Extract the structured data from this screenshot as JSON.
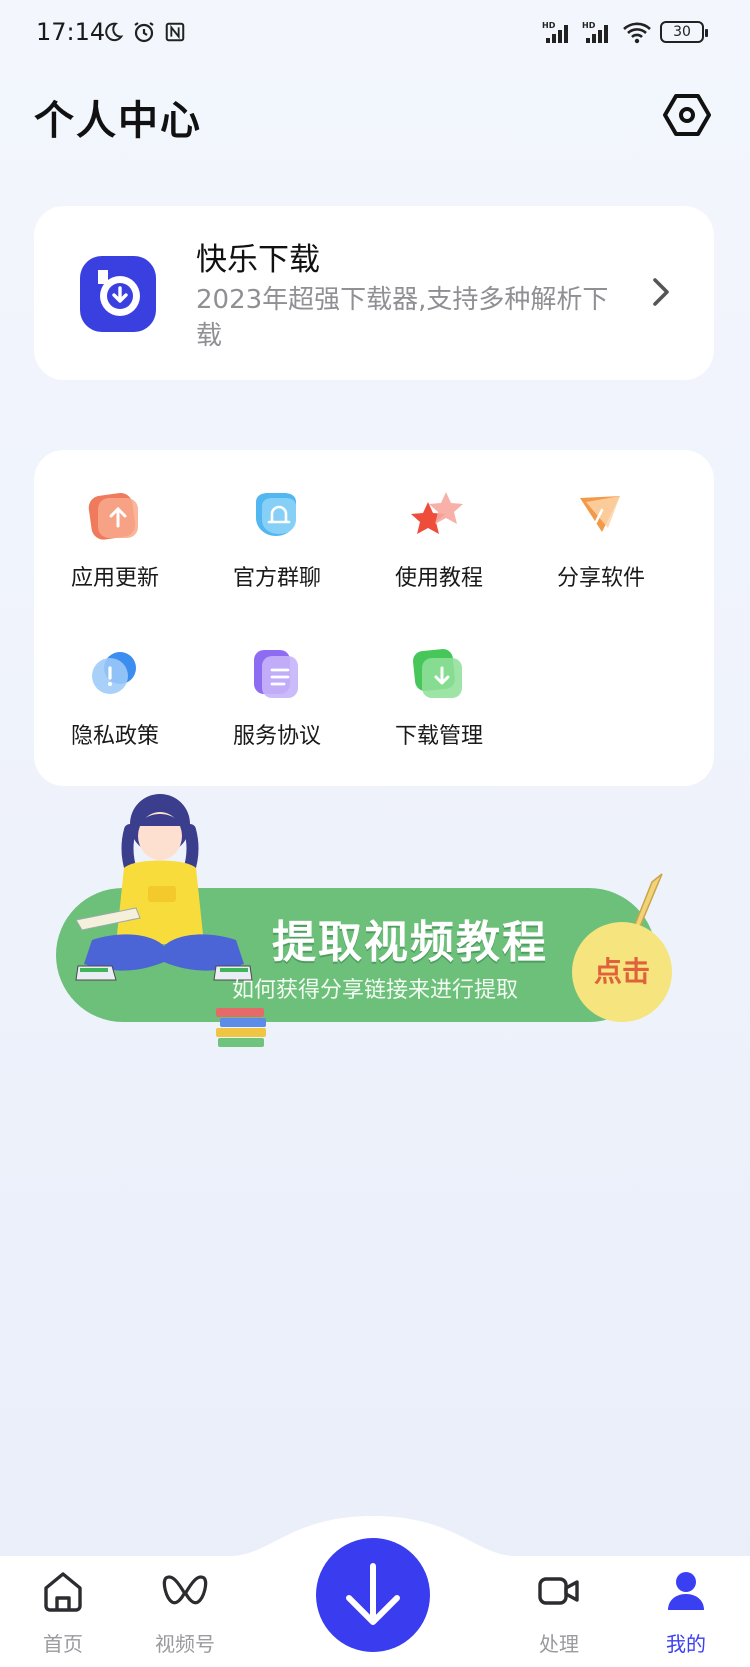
{
  "status_bar": {
    "time": "17:14",
    "battery": "30",
    "left_icons": [
      "moon-icon",
      "alarm-icon",
      "nfc-icon"
    ],
    "right_icons": [
      "hd-signal-icon",
      "hd-signal-icon",
      "wifi-icon",
      "battery-icon"
    ]
  },
  "header": {
    "title": "个人中心",
    "settings_icon": "settings-hex-icon"
  },
  "app_card": {
    "name": "快乐下载",
    "description": "2023年超强下载器,支持多种解析下载",
    "logo_icon": "download-logo-icon",
    "accent": "#3a3fe0"
  },
  "menu": {
    "items": [
      {
        "label": "应用更新",
        "icon": "upload-icon",
        "color": "#f07a5c"
      },
      {
        "label": "官方群聊",
        "icon": "chat-bell-icon",
        "color": "#52b7f0"
      },
      {
        "label": "使用教程",
        "icon": "star-icon",
        "color": "#ee4d3b"
      },
      {
        "label": "分享软件",
        "icon": "share-icon",
        "color": "#f39a4a"
      },
      {
        "label": "隐私政策",
        "icon": "privacy-icon",
        "color": "#3b8df0"
      },
      {
        "label": "服务协议",
        "icon": "document-icon",
        "color": "#8d6cf2"
      },
      {
        "label": "下载管理",
        "icon": "download-manage-icon",
        "color": "#47c65a"
      }
    ]
  },
  "banner": {
    "title": "提取视频教程",
    "subtitle": "如何获得分享链接来进行提取",
    "cta": "点击",
    "color": "#6cc07a"
  },
  "bottom_nav": {
    "items": [
      {
        "label": "首页",
        "icon": "home-icon"
      },
      {
        "label": "视频号",
        "icon": "video-channel-icon"
      },
      {
        "label": "处理",
        "icon": "video-camera-icon"
      },
      {
        "label": "我的",
        "icon": "user-icon"
      }
    ],
    "center_icon": "download-arrow-icon",
    "active": "我的",
    "accent": "#3a3cf0"
  }
}
